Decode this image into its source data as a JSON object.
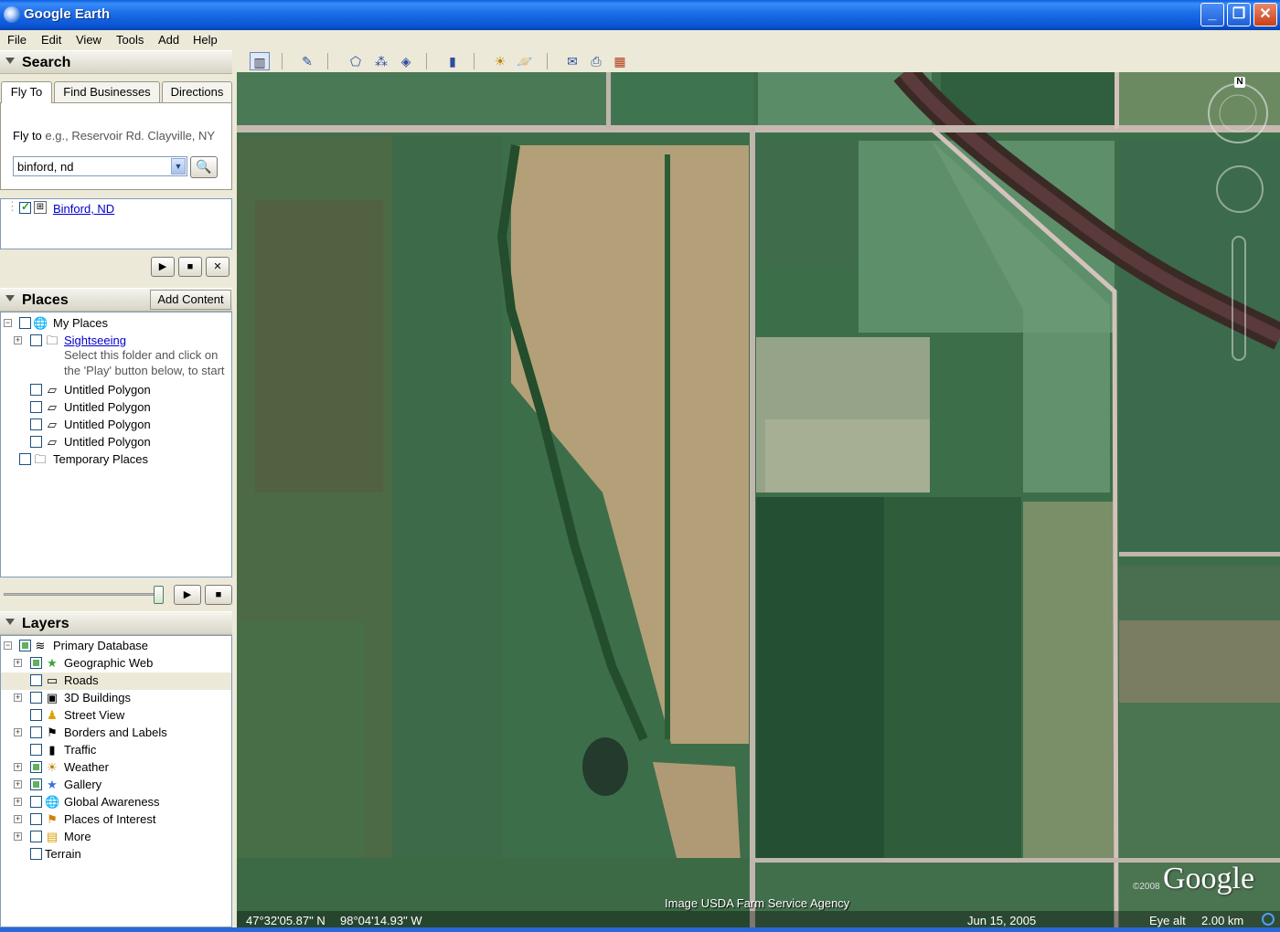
{
  "window": {
    "title": "Google Earth",
    "min": "_",
    "max": "❐",
    "close": "✕"
  },
  "menu": [
    "File",
    "Edit",
    "View",
    "Tools",
    "Add",
    "Help"
  ],
  "search": {
    "header": "Search",
    "tabs": [
      "Fly To",
      "Find Businesses",
      "Directions"
    ],
    "fly_to_label": "Fly to",
    "fly_to_hint": "e.g., Reservoir Rd. Clayville, NY",
    "input_value": "binford, nd",
    "result": "Binford, ND"
  },
  "places": {
    "header": "Places",
    "add_content": "Add Content",
    "my_places": "My Places",
    "sightseeing": "Sightseeing",
    "sightseeing_note1": "Select this folder and click on",
    "sightseeing_note2": "the 'Play' button below, to start",
    "polygons": [
      "Untitled Polygon",
      "Untitled Polygon",
      "Untitled Polygon",
      "Untitled Polygon"
    ],
    "temporary": "Temporary Places"
  },
  "layers": {
    "header": "Layers",
    "items": [
      "Primary Database",
      "Geographic Web",
      "Roads",
      "3D Buildings",
      "Street View",
      "Borders and Labels",
      "Traffic",
      "Weather",
      "Gallery",
      "Global Awareness",
      "Places of Interest",
      "More",
      "Terrain"
    ]
  },
  "map": {
    "image_credit": "Image USDA Farm Service Agency",
    "logo": "Google",
    "copyright": "©2008",
    "north": "N",
    "lat": "47°32'05.87\" N",
    "lon": "98°04'14.93\" W",
    "date": "Jun 15, 2005",
    "eye_alt_label": "Eye alt",
    "eye_alt_value": "2.00 km"
  }
}
